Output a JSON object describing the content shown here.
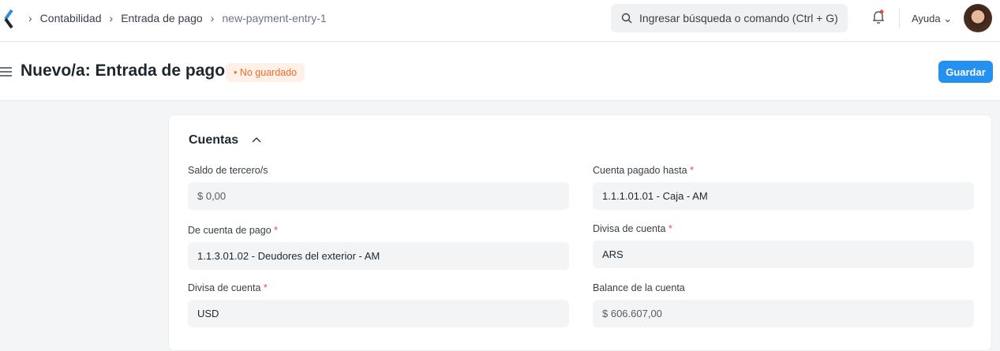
{
  "breadcrumbs": [
    "Contabilidad",
    "Entrada de pago",
    "new-payment-entry-1"
  ],
  "search": {
    "placeholder": "Ingresar búsqueda o comando (Ctrl + G)"
  },
  "help_label": "Ayuda",
  "page": {
    "title": "Nuevo/a: Entrada de pago",
    "status": "No guardado",
    "save_label": "Guardar"
  },
  "section": {
    "title": "Cuentas"
  },
  "fields": [
    {
      "label": "Saldo de tercero/s",
      "value": "$ 0,00",
      "required": ""
    },
    {
      "label": "Cuenta pagado hasta",
      "value": "1.1.1.01.01 - Caja - AM",
      "required": "*"
    },
    {
      "label": "De cuenta de pago",
      "value": "1.1.3.01.02 - Deudores del exterior - AM",
      "required": "*"
    },
    {
      "label": "Divisa de cuenta",
      "value": "ARS",
      "required": "*"
    },
    {
      "label": "Divisa de cuenta",
      "value": "USD",
      "required": "*"
    },
    {
      "label": "Balance de la cuenta",
      "value": "$ 606.607,00",
      "required": ""
    }
  ]
}
